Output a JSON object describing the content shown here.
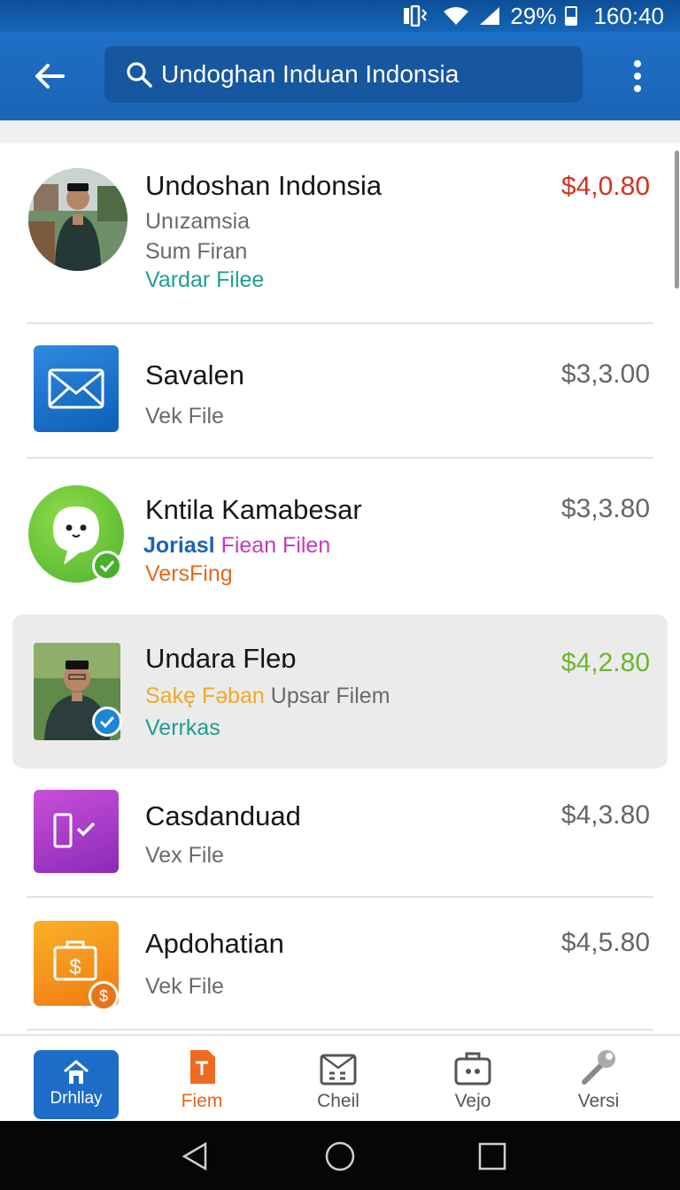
{
  "status_bar": {
    "battery": "29%",
    "time": "160:40"
  },
  "app_bar": {
    "search_value": "Undoghan Induan Indonsia",
    "accent": "#1e6fc6"
  },
  "items": [
    {
      "title": "Undoshan Indonsia",
      "lines": [
        "Unızamsia",
        "Sum Firan"
      ],
      "tag": "Vardar Filee",
      "price": "$4,0.80",
      "price_color": "#d2321f"
    },
    {
      "title": "Savalen",
      "lines": [
        "Vek File"
      ],
      "price": "$3,3.00"
    },
    {
      "title": "Kntila Kamabesar",
      "tag_a": "Joriasl",
      "tag_b": "Fiean Filen",
      "tag_c": "VersFing",
      "price": "$3,3.80"
    },
    {
      "title": "Undara Fleɒ",
      "tag_a": "Sakę Fəban",
      "tag_b": "Upsar Filem",
      "tag_c": "Verrkas",
      "price": "$4,2.80",
      "price_color": "#6fb52c"
    },
    {
      "title": "Casdanduad",
      "lines": [
        "Vex File"
      ],
      "price": "$4,3.80"
    },
    {
      "title": "Apdohatian",
      "lines": [
        "Vek File"
      ],
      "price": "$4,5.80"
    }
  ],
  "bottom_nav": [
    {
      "label": "Drhllay",
      "icon": "home-icon"
    },
    {
      "label": "Fiem",
      "icon": "file-icon"
    },
    {
      "label": "Cheil",
      "icon": "calendar-icon"
    },
    {
      "label": "Vejo",
      "icon": "briefcase-icon"
    },
    {
      "label": "Versi",
      "icon": "wrench-icon"
    }
  ],
  "icons": {
    "envelope": "mail-icon",
    "chat": "chat-bubble-icon",
    "device_check": "phone-check-icon",
    "money": "money-bag-icon"
  }
}
